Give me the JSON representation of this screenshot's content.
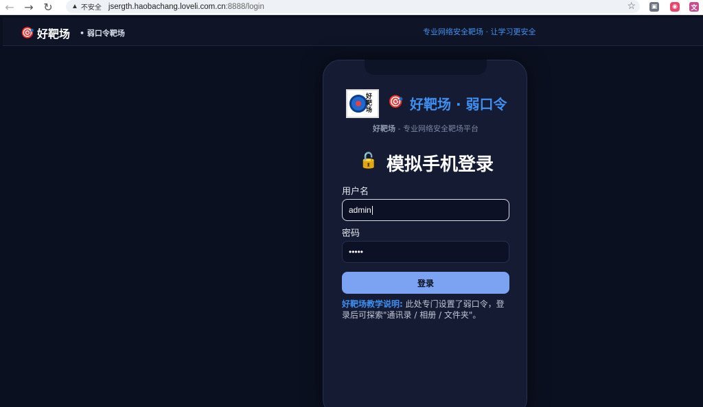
{
  "browser": {
    "back": "←",
    "forward": "→",
    "reload": "↻",
    "warning_icon": "▲",
    "insecure_label": "不安全",
    "url_host": "jsergth.haobachang.loveli.com.cn",
    "url_rest": ":8888/login",
    "star": "☆"
  },
  "header": {
    "brand_icon": "🎯",
    "brand": "好靶场",
    "brand_sub": "• 弱口令靶场",
    "slogan": "专业网络安全靶场 · 让学习更安全"
  },
  "card": {
    "logo_text": "好靶场",
    "title_icon": "🎯",
    "title": "好靶场 · 弱口令",
    "subtitle_brand": "好靶场",
    "subtitle_rest": " - 专业网络安全靶场平台",
    "login_icon": "🔓",
    "login_title": "模拟手机登录",
    "username_label": "用户名",
    "username_value": "admin",
    "password_label": "密码",
    "password_value": "•••••",
    "login_button": "登录",
    "note_label": "好靶场教学说明:",
    "note_text": " 此处专门设置了弱口令，登录后可探索\"通讯录 / 相册 / 文件夹\"。"
  }
}
